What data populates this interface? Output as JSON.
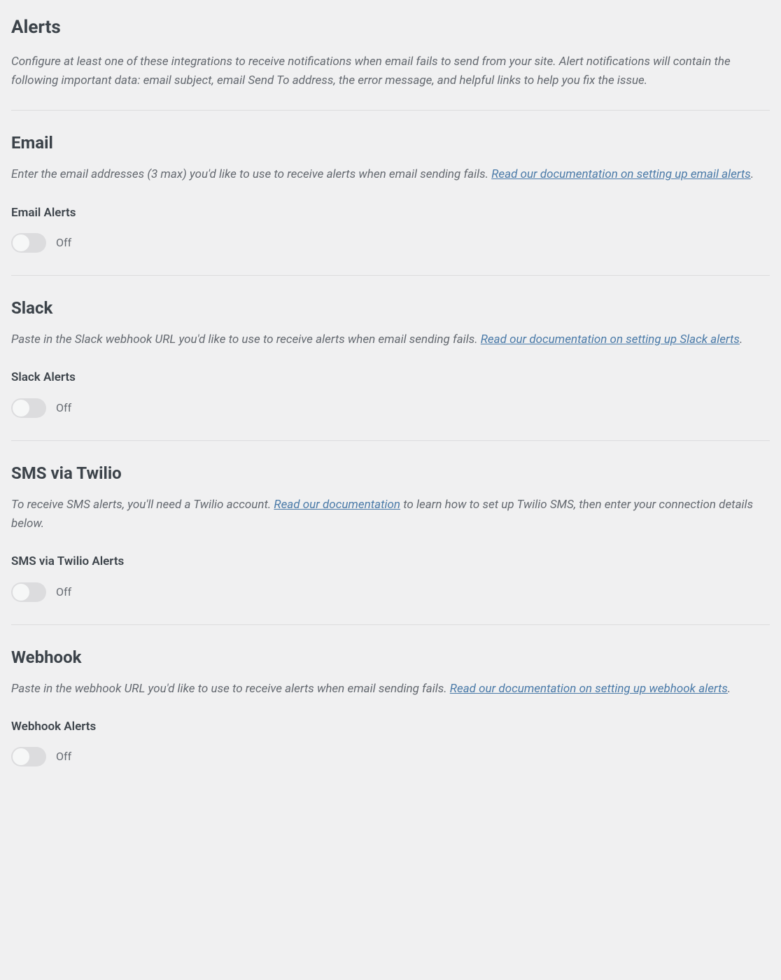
{
  "alerts": {
    "title": "Alerts",
    "description": "Configure at least one of these integrations to receive notifications when email fails to send from your site. Alert notifications will contain the following important data: email subject, email Send To address, the error message, and helpful links to help you fix the issue."
  },
  "email": {
    "title": "Email",
    "desc_before": "Enter the email addresses (3 max) you'd like to use to receive alerts when email sending fails. ",
    "link": "Read our documentation on setting up email alerts",
    "desc_after": ".",
    "field_label": "Email Alerts",
    "toggle_state": "Off"
  },
  "slack": {
    "title": "Slack",
    "desc_before": "Paste in the Slack webhook URL you'd like to use to receive alerts when email sending fails. ",
    "link": "Read our documentation on setting up Slack alerts",
    "desc_after": ".",
    "field_label": "Slack Alerts",
    "toggle_state": "Off"
  },
  "sms": {
    "title": "SMS via Twilio",
    "desc_before": "To receive SMS alerts, you'll need a Twilio account. ",
    "link": "Read our documentation",
    "desc_after": " to learn how to set up Twilio SMS, then enter your connection details below.",
    "field_label": "SMS via Twilio Alerts",
    "toggle_state": "Off"
  },
  "webhook": {
    "title": "Webhook",
    "desc_before": "Paste in the webhook URL you'd like to use to receive alerts when email sending fails. ",
    "link": "Read our documentation on setting up webhook alerts",
    "desc_after": ".",
    "field_label": "Webhook Alerts",
    "toggle_state": "Off"
  }
}
